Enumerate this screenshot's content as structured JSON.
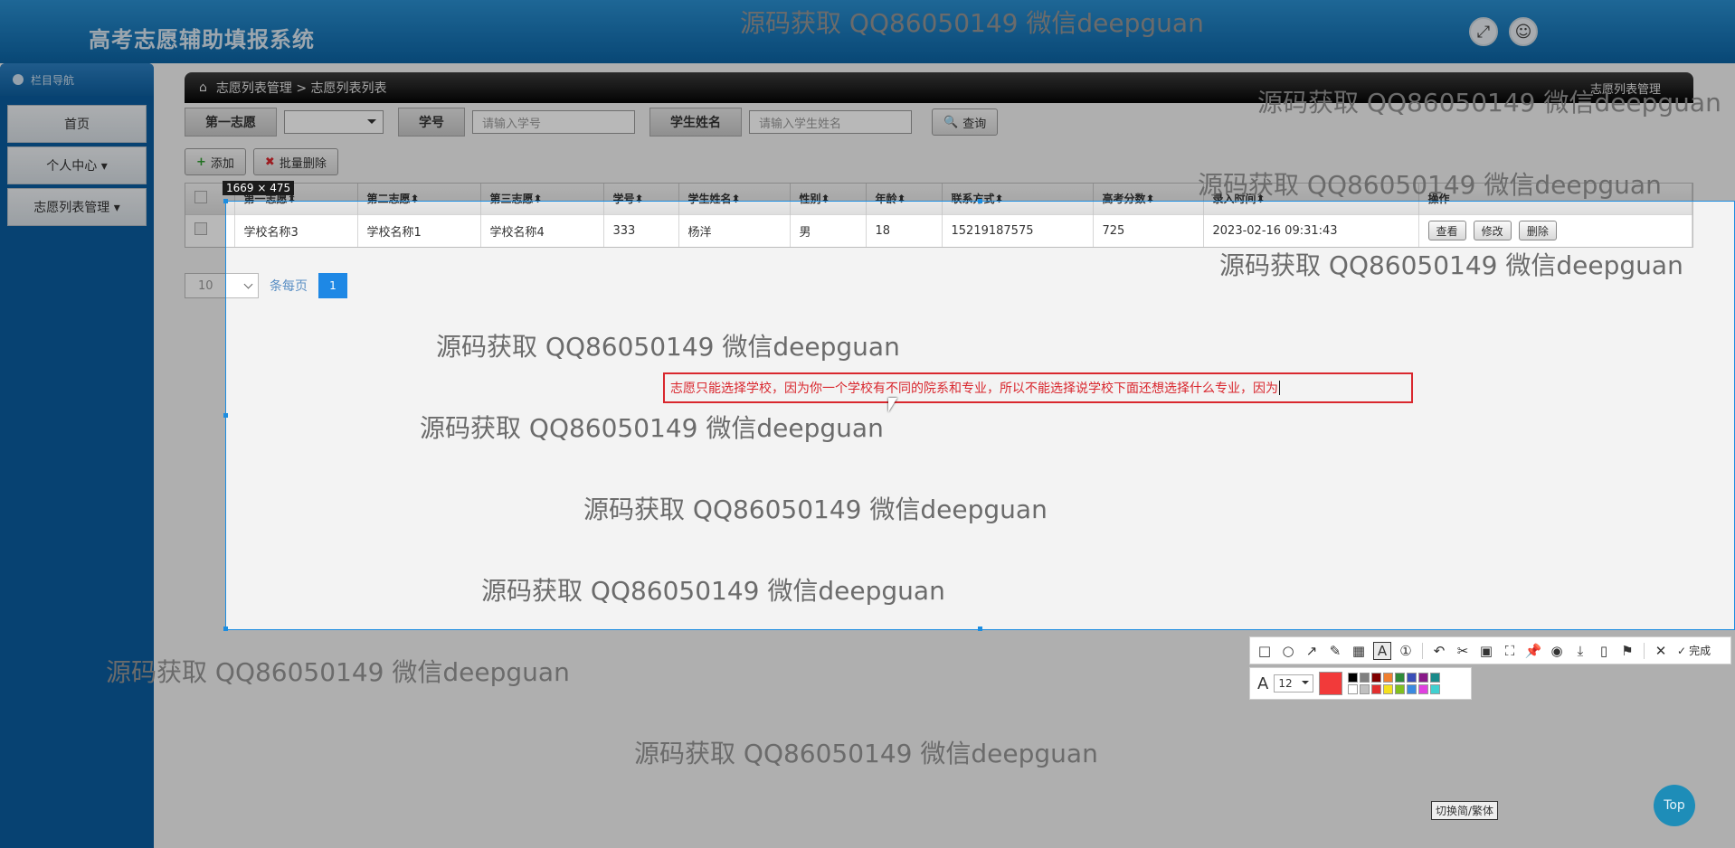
{
  "app": {
    "title": "高考志愿辅助填报系统"
  },
  "topbar": {
    "fullscreen_icon": "expand-icon",
    "user_icon": "user-icon"
  },
  "sidebar": {
    "header": "栏目导航",
    "items": [
      {
        "label": "首页"
      },
      {
        "label": "个人中心 ▾"
      },
      {
        "label": "志愿列表管理 ▾"
      }
    ]
  },
  "breadcrumb": {
    "home_icon": "home-icon",
    "path": "志愿列表管理 > 志愿列表列表",
    "right_title": "志愿列表管理"
  },
  "filters": {
    "first_choice_label": "第一志愿",
    "student_id_label": "学号",
    "student_id_placeholder": "请输入学号",
    "student_name_label": "学生姓名",
    "student_name_placeholder": "请输入学生姓名",
    "search_label": "查询"
  },
  "actions": {
    "add_label": "添加",
    "batch_delete_label": "批量删除"
  },
  "table": {
    "columns": [
      "第一志愿",
      "第二志愿",
      "第三志愿",
      "学号",
      "学生姓名",
      "性别",
      "年龄",
      "联系方式",
      "高考分数",
      "录入时间",
      "操作"
    ],
    "rows": [
      {
        "first": "学校名称3",
        "second": "学校名称1",
        "third": "学校名称4",
        "student_id": "333",
        "name": "杨洋",
        "gender": "男",
        "age": "18",
        "phone": "15219187575",
        "score": "725",
        "time": "2023-02-16 09:31:43"
      }
    ],
    "row_actions": {
      "view": "查看",
      "edit": "修改",
      "delete": "删除"
    }
  },
  "pager": {
    "page_size": "10",
    "per_page_label": "条每页",
    "current_page": "1"
  },
  "capture": {
    "size_label": "1669 × 475",
    "annotation_text": "志愿只能选择学校，因为你一个学校有不同的院系和专业，所以不能选择说学校下面还想选择什么专业，因为",
    "font_size": "12",
    "done_label": "完成",
    "current_color": "#f23a3a",
    "palette": [
      "#000000",
      "#808080",
      "#800000",
      "#f08030",
      "#2e8b3a",
      "#3a4fb8",
      "#8a1a8a",
      "#1a8a8a",
      "#ffffff",
      "#c0c0c0",
      "#e23030",
      "#f5e020",
      "#80c020",
      "#3a8ae0",
      "#e040e0",
      "#40d0d0"
    ]
  },
  "watermark": "源码获取 QQ86050149 微信deepguan",
  "footer": {
    "lang_toggle": "切换简/繁体",
    "top_label": "Top"
  }
}
